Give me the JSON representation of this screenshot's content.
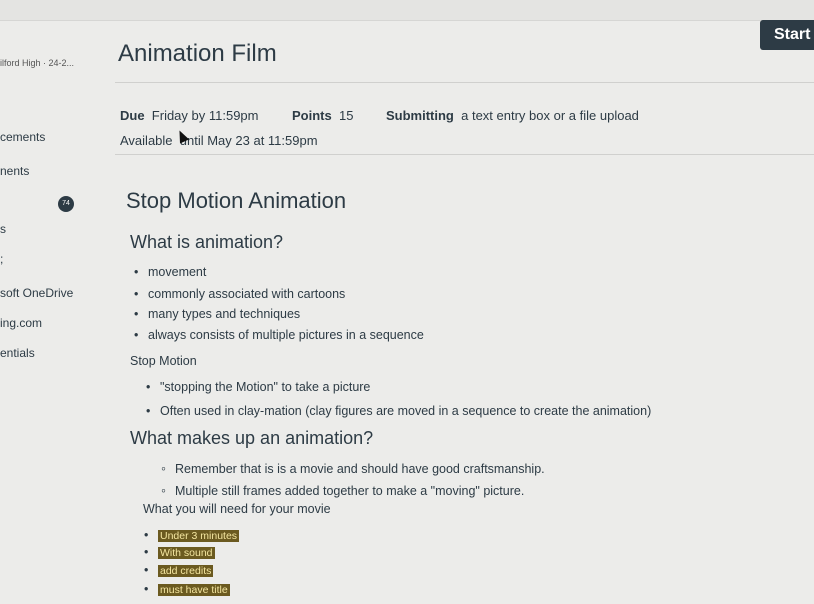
{
  "header": {
    "start_label": "Start",
    "course_tag": "ilford High · 24-2..."
  },
  "sidebar": {
    "items": [
      {
        "label": "cements"
      },
      {
        "label": "nents"
      },
      {
        "label": "s"
      },
      {
        "label": ";"
      },
      {
        "label": "soft OneDrive"
      },
      {
        "label": "ing.com"
      },
      {
        "label": "entials"
      }
    ]
  },
  "assignment": {
    "title": "Animation Film",
    "due_label": "Due",
    "due_value": "Friday by 11:59pm",
    "points_label": "Points",
    "points_value": "15",
    "submitting_label": "Submitting",
    "submitting_value": "a text entry box or a file upload",
    "available_label": "Available",
    "available_value": "until May 23 at 11:59pm"
  },
  "content": {
    "badge": "74",
    "section_title": "Stop Motion Animation",
    "q1": "What is animation?",
    "q1_bullets": [
      "movement",
      "commonly associated with cartoons",
      "many types and techniques",
      "always consists of multiple pictures in a sequence"
    ],
    "stop_motion_label": "Stop Motion",
    "stop_motion_bullets": [
      "\"stopping the Motion\" to take a picture",
      "Often used in clay-mation (clay figures are moved in a sequence to create the animation)"
    ],
    "q2": "What makes up an animation?",
    "q2_bullets": [
      "Remember that is is a movie and should have good craftsmanship.",
      "Multiple still frames added together to make a \"moving\" picture."
    ],
    "need_label": "What you will need for your movie",
    "need_bullets": [
      "Under 3 minutes",
      "With sound",
      "add credits",
      "must have title"
    ],
    "highlight_color": "#6b5a20"
  }
}
